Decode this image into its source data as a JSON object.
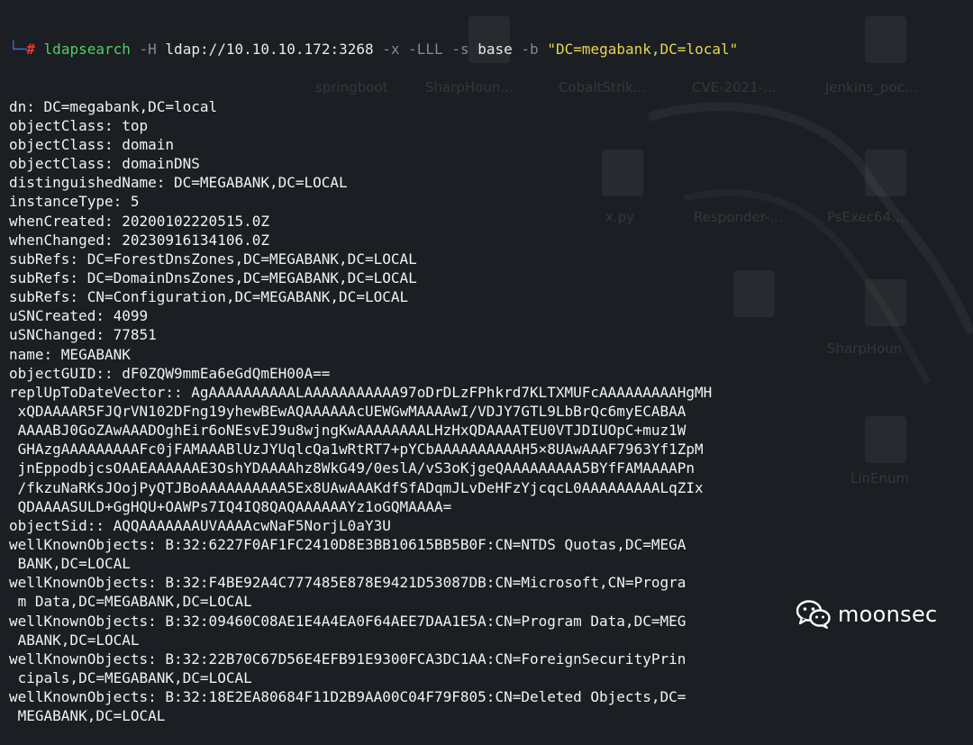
{
  "terminal": {
    "prompt_corner": "└─",
    "prompt_hash": "#",
    "command": {
      "program": "ldapsearch",
      "flag_h": "-H",
      "host": "ldap://10.10.10.172:3268",
      "flag_x": "-x",
      "flag_lll": "-LLL",
      "flag_s": "-s",
      "scope": "base",
      "flag_b": "-b",
      "base_dn": "\"DC=megabank,DC=local\""
    },
    "lines": [
      "dn: DC=megabank,DC=local",
      "objectClass: top",
      "objectClass: domain",
      "objectClass: domainDNS",
      "distinguishedName: DC=MEGABANK,DC=LOCAL",
      "instanceType: 5",
      "whenCreated: 20200102220515.0Z",
      "whenChanged: 20230916134106.0Z",
      "subRefs: DC=ForestDnsZones,DC=MEGABANK,DC=LOCAL",
      "subRefs: DC=DomainDnsZones,DC=MEGABANK,DC=LOCAL",
      "subRefs: CN=Configuration,DC=MEGABANK,DC=LOCAL",
      "uSNCreated: 4099",
      "uSNChanged: 77851",
      "name: MEGABANK",
      "objectGUID:: dF0ZQW9mmEa6eGdQmEH00A==",
      "replUpToDateVector:: AgAAAAAAAAAALAAAAAAAAAAA97oDrDLzFPhkrd7KLTXMUFcAAAAAAAAAHgMH",
      " xQDAAAAR5FJQrVN102DFng19yhewBEwAQAAAAAAcUEWGwMAAAAwI/VDJY7GTL9LbBrQc6myECABAA",
      " AAAABJ0GoZAwAAADOghEir6oNEsvEJ9u8wjngKwAAAAAAAALHzHxQDAAAATEU0VTJDIUOpC+muz1W",
      " GHAzgAAAAAAAAAFc0jFAMAAABlUzJYUqlcQa1wRtRT7+pYCbAAAAAAAAAAH5×8UAwAAAF7963Yf1ZpM",
      " jnEppodbjcsOAAEAAAAAAE3OshYDAAAAhz8WkG49/0eslA/vS3oKjgeQAAAAAAAAA5BYfFAMAAAAPn",
      " /fkzuNaRKsJOojPyQTJBoAAAAAAAAAA5Ex8UAwAAAKdfSfADqmJLvDeHFzYjcqcL0AAAAAAAAALqZIx",
      " QDAAAASULD+GgHQU+OAWPs7IQ4IQ8QAQAAAAAAYz1oGQMAAAA=",
      "objectSid:: AQQAAAAAAAUVAAAAcwNaF5NorjL0aY3U",
      "wellKnownObjects: B:32:6227F0AF1FC2410D8E3BB10615BB5B0F:CN=NTDS Quotas,DC=MEGA",
      " BANK,DC=LOCAL",
      "wellKnownObjects: B:32:F4BE92A4C777485E878E9421D53087DB:CN=Microsoft,CN=Progra",
      " m Data,DC=MEGABANK,DC=LOCAL",
      "wellKnownObjects: B:32:09460C08AE1E4A4EA0F64AEE7DAA1E5A:CN=Program Data,DC=MEG",
      " ABANK,DC=LOCAL",
      "wellKnownObjects: B:32:22B70C67D56E4EFB91E9300FCA3DC1AA:CN=ForeignSecurityPrin",
      " cipals,DC=MEGABANK,DC=LOCAL",
      "wellKnownObjects: B:32:18E2EA80684F11D2B9AA00C04F79F805:CN=Deleted Objects,DC=",
      " MEGABANK,DC=LOCAL"
    ]
  },
  "desktop_icons": [
    {
      "label": "springboot"
    },
    {
      "label": "SharpHoun..."
    },
    {
      "label": "CobaltStrik..."
    },
    {
      "label": "CVE-2021-..."
    },
    {
      "label": "Jenkins_poc..."
    },
    {
      "label": "x.py"
    },
    {
      "label": "Responder-..."
    },
    {
      "label": "PsExec64..."
    },
    {
      "label": "SharpHoun"
    },
    {
      "label": "LinEnum"
    }
  ],
  "watermark": {
    "text": "moonsec",
    "icon": "wechat-icon"
  },
  "colors": {
    "background": "#1b1e23",
    "text": "#f2f2f2",
    "command_green": "#4fd15f",
    "flag_gray": "#7f8b98",
    "string_yellow": "#e8d44d",
    "prompt_blue": "#3a78d6",
    "prompt_red": "#e53935"
  }
}
